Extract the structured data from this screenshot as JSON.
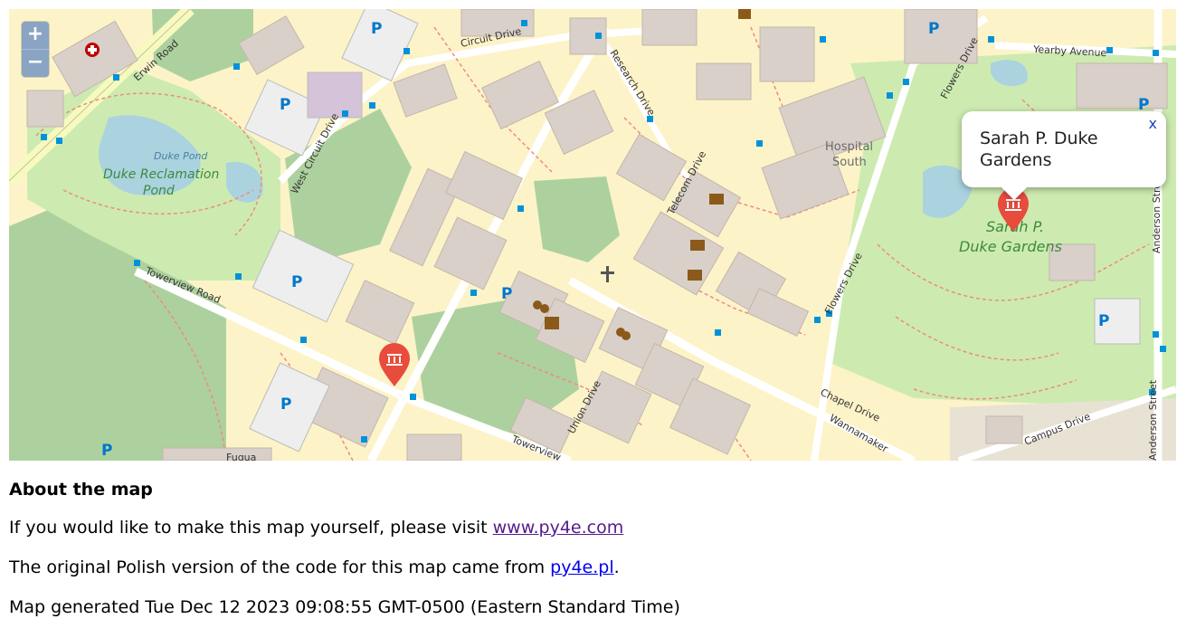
{
  "map": {
    "zoom_in": "+",
    "zoom_out": "−",
    "popup_text": "Sarah P. Duke Gardens",
    "popup_close": "x",
    "labels": {
      "erwin_road": "Erwin Road",
      "circuit_drive": "Circuit Drive",
      "research_drive": "Research Drive",
      "yearby_avenue": "Yearby Avenue",
      "flowers_drive_top": "Flowers Drive",
      "flowers_drive_bottom": "Flowers Drive",
      "duke_pond": "Duke Pond",
      "duke_reclamation_1": "Duke Reclamation",
      "duke_reclamation_2": "Pond",
      "west_circuit_drive": "West Circuit Drive",
      "hospital_1": "Hospital",
      "hospital_2": "South",
      "telecom_drive": "Telecom Drive",
      "gardens_1": "Sarah P.",
      "gardens_2": "Duke Gardens",
      "anderson_street": "Anderson Street",
      "towerview_road": "Towerview Road",
      "towerview_bottom": "Towerview",
      "union_drive": "Union Drive",
      "chapel_drive": "Chapel Drive",
      "wannamaker": "Wannamaker",
      "campus_drive": "Campus Drive",
      "anderson_street_bottom": "Anderson Street",
      "fuqua": "Fuqua",
      "parking": "P"
    },
    "colors": {
      "land": "#fdf3c8",
      "park": "#cdebb0",
      "wood": "#add19e",
      "water": "#aad3df",
      "building": "#d9d0c9",
      "marker": "#e74c3c"
    }
  },
  "info": {
    "heading": "About the map",
    "line1_prefix": "If you would like to make this map yourself, please visit ",
    "line1_link": "www.py4e.com",
    "line2_prefix": "The original Polish version of the code for this map came from ",
    "line2_link": "py4e.pl",
    "line2_suffix": ".",
    "line3": "Map generated Tue Dec 12 2023 09:08:55 GMT-0500 (Eastern Standard Time)"
  }
}
